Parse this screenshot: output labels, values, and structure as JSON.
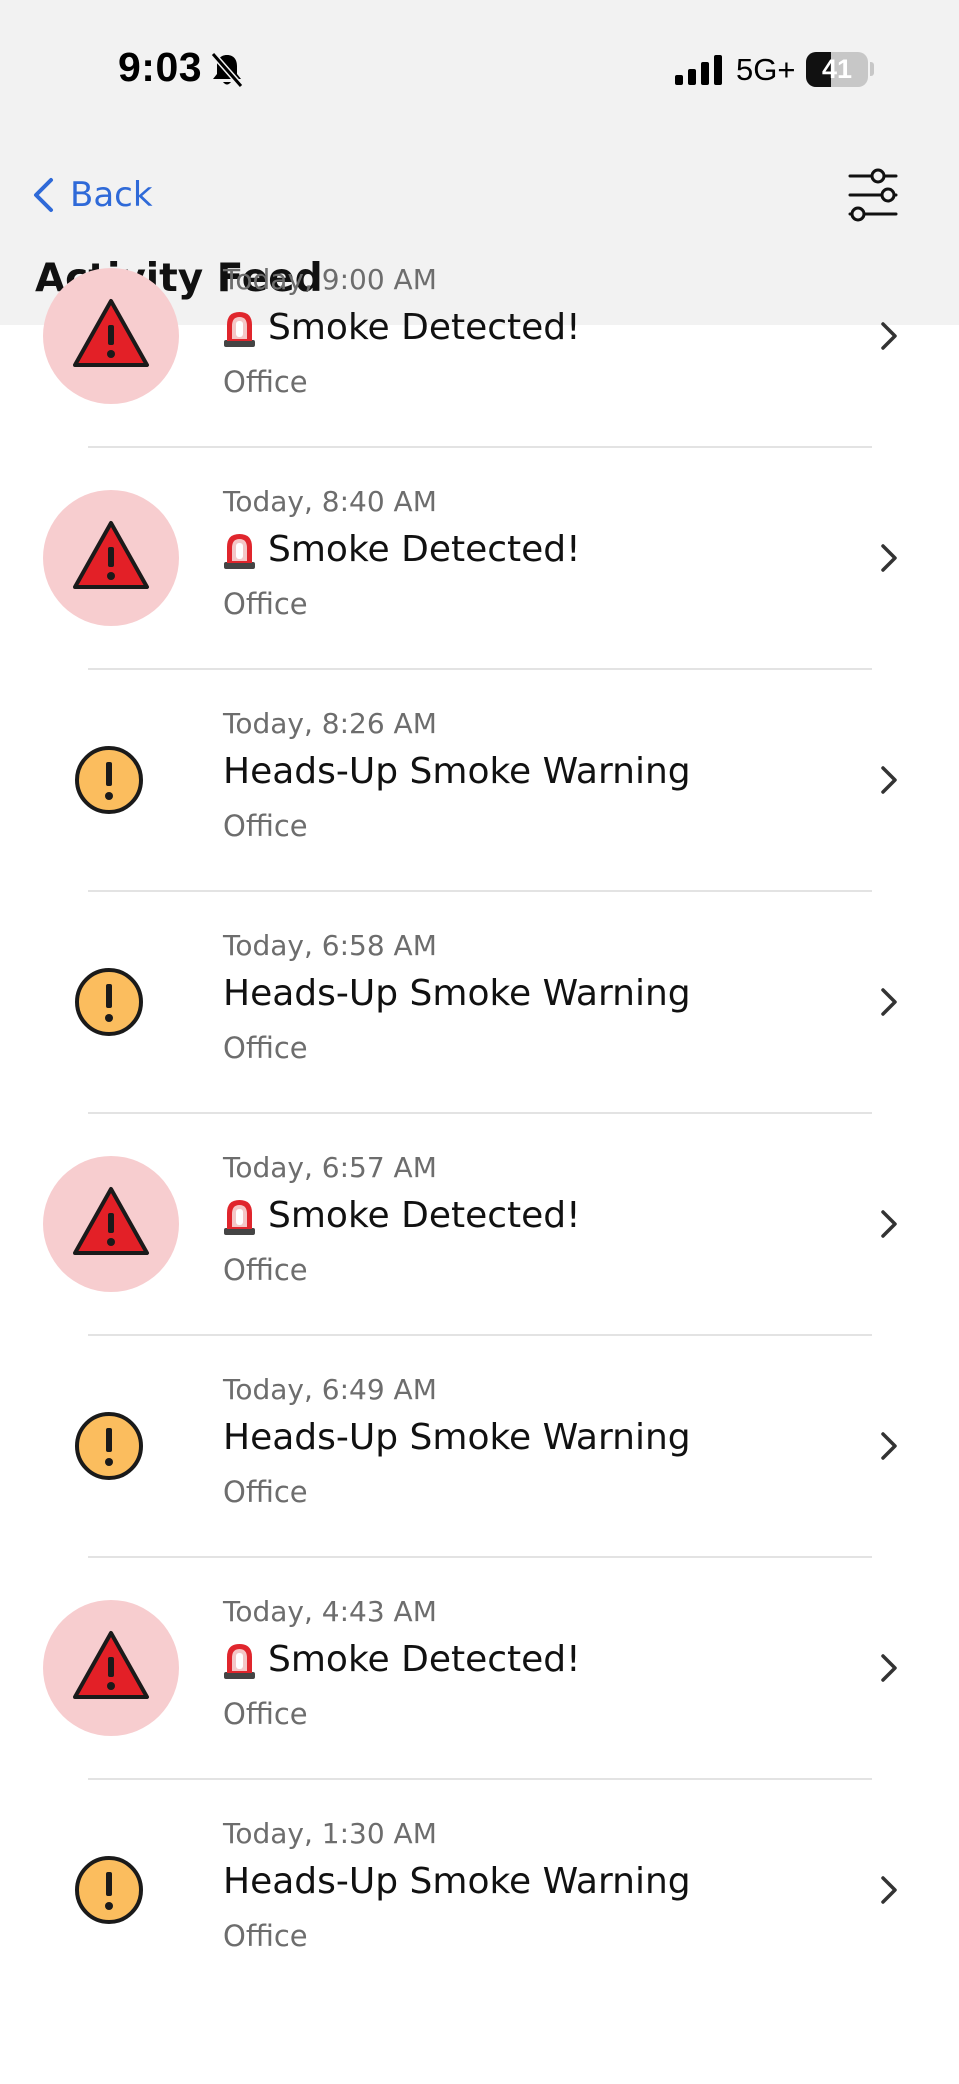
{
  "status_bar": {
    "time": "9:03",
    "network": "5G+",
    "battery": "41",
    "battery_level_percent": 41
  },
  "nav": {
    "back_label": "Back",
    "title": "Activity Feed"
  },
  "icons": {
    "back": "chevron-left-icon",
    "filter": "sliders-icon",
    "alarm": "triangle-alert-icon",
    "warning": "exclamation-circle-icon",
    "siren": "police-light-emoji"
  },
  "colors": {
    "accent": "#2f6ad8",
    "alarm_red": "#e32027",
    "alarm_bg": "#f7cdcf",
    "warning_yellow": "#fbbd5e"
  },
  "feed": [
    {
      "type": "alarm",
      "time": "Today, 9:00 AM",
      "title": "Smoke Detected!",
      "location": "Office"
    },
    {
      "type": "alarm",
      "time": "Today, 8:40 AM",
      "title": "Smoke Detected!",
      "location": "Office"
    },
    {
      "type": "warning",
      "time": "Today, 8:26 AM",
      "title": "Heads-Up Smoke Warning",
      "location": "Office"
    },
    {
      "type": "warning",
      "time": "Today, 6:58 AM",
      "title": "Heads-Up Smoke Warning",
      "location": "Office"
    },
    {
      "type": "alarm",
      "time": "Today, 6:57 AM",
      "title": "Smoke Detected!",
      "location": "Office"
    },
    {
      "type": "warning",
      "time": "Today, 6:49 AM",
      "title": "Heads-Up Smoke Warning",
      "location": "Office"
    },
    {
      "type": "alarm",
      "time": "Today, 4:43 AM",
      "title": "Smoke Detected!",
      "location": "Office"
    },
    {
      "type": "warning",
      "time": "Today, 1:30 AM",
      "title": "Heads-Up Smoke Warning",
      "location": "Office"
    }
  ]
}
